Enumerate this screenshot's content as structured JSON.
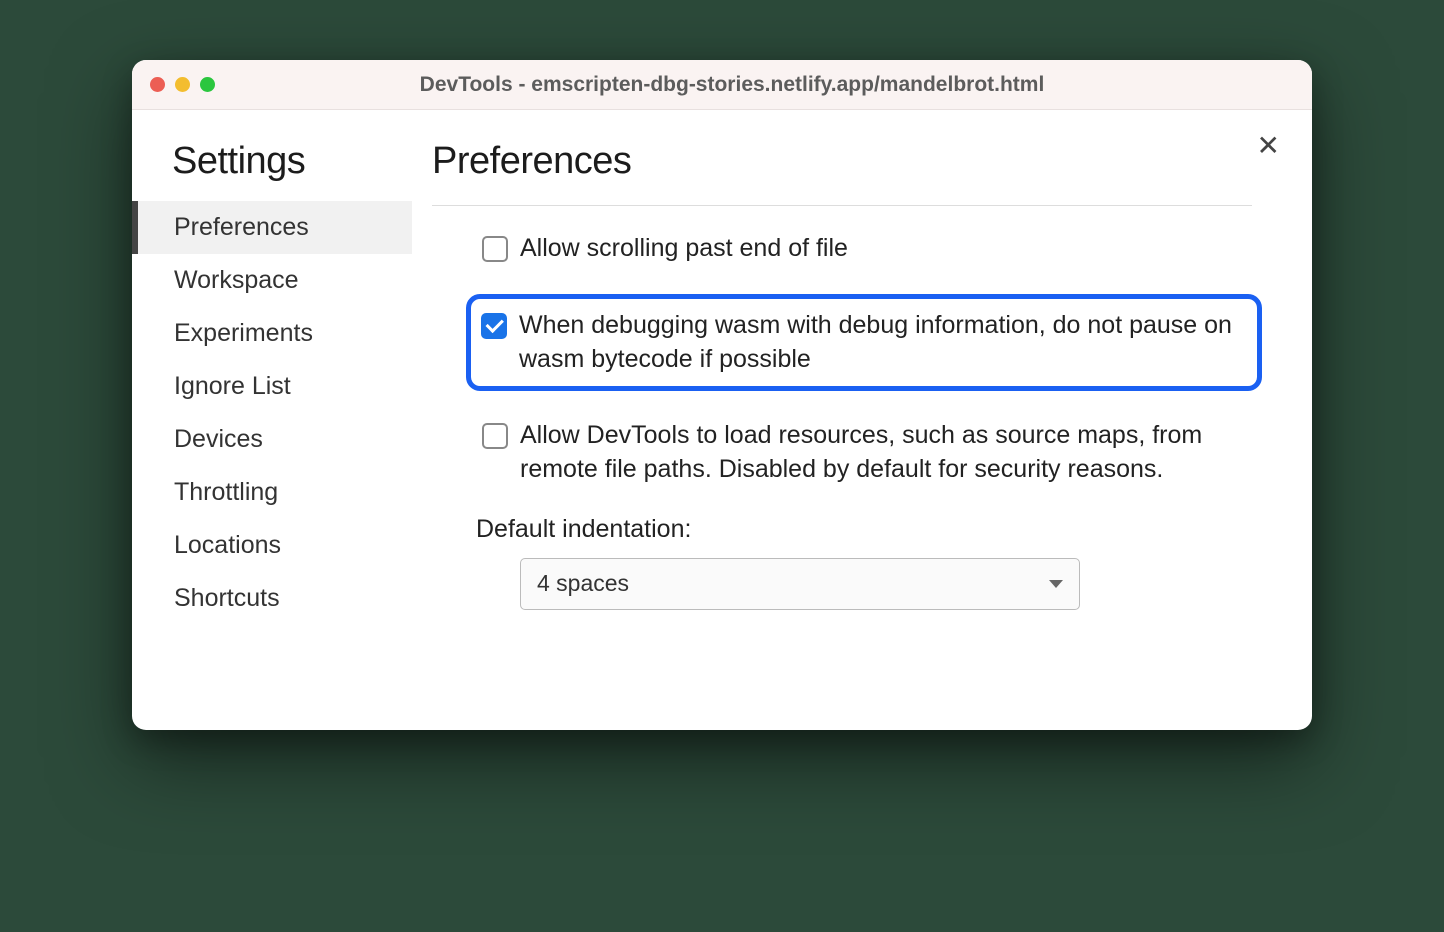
{
  "titlebar": {
    "title": "DevTools - emscripten-dbg-stories.netlify.app/mandelbrot.html"
  },
  "sidebar": {
    "title": "Settings",
    "items": [
      {
        "label": "Preferences",
        "active": true
      },
      {
        "label": "Workspace",
        "active": false
      },
      {
        "label": "Experiments",
        "active": false
      },
      {
        "label": "Ignore List",
        "active": false
      },
      {
        "label": "Devices",
        "active": false
      },
      {
        "label": "Throttling",
        "active": false
      },
      {
        "label": "Locations",
        "active": false
      },
      {
        "label": "Shortcuts",
        "active": false
      }
    ]
  },
  "main": {
    "heading": "Preferences",
    "settings": [
      {
        "label": "Allow scrolling past end of file",
        "checked": false,
        "highlighted": false
      },
      {
        "label": "When debugging wasm with debug information, do not pause on wasm bytecode if possible",
        "checked": true,
        "highlighted": true
      },
      {
        "label": "Allow DevTools to load resources, such as source maps, from remote file paths. Disabled by default for security reasons.",
        "checked": false,
        "highlighted": false
      }
    ],
    "indentation": {
      "label": "Default indentation:",
      "value": "4 spaces"
    }
  }
}
